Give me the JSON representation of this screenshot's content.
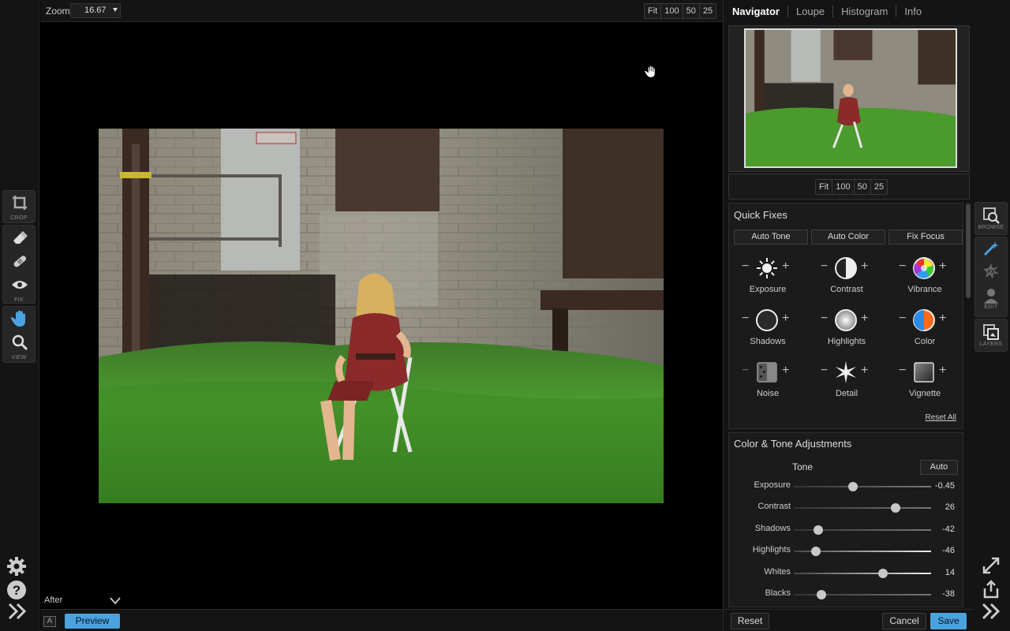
{
  "left_tools": {
    "crop_label": "CROP",
    "fix_label": "FIX",
    "view_label": "VIEW"
  },
  "top_bar": {
    "zoom_label": "Zoom",
    "zoom_value": "16.67",
    "zoom_buttons": [
      "Fit",
      "100",
      "50",
      "25"
    ]
  },
  "bottom_bar": {
    "after_label": "After",
    "a_badge": "A",
    "preview_label": "Preview"
  },
  "navigator": {
    "tabs": [
      "Navigator",
      "Loupe",
      "Histogram",
      "Info"
    ],
    "zoom_buttons": [
      "Fit",
      "100",
      "50",
      "25"
    ]
  },
  "quick_fixes": {
    "title": "Quick Fixes",
    "buttons": [
      "Auto Tone",
      "Auto Color",
      "Fix Focus"
    ],
    "items": [
      "Exposure",
      "Contrast",
      "Vibrance",
      "Shadows",
      "Highlights",
      "Color",
      "Noise",
      "Detail",
      "Vignette"
    ],
    "reset_all": "Reset All"
  },
  "adjustments": {
    "title": "Color & Tone Adjustments",
    "tone_title": "Tone",
    "auto_label": "Auto",
    "sliders": [
      {
        "label": "Exposure",
        "value": "-0.45",
        "pos": 0.43
      },
      {
        "label": "Contrast",
        "value": "26",
        "pos": 0.74
      },
      {
        "label": "Shadows",
        "value": "-42",
        "pos": 0.18
      },
      {
        "label": "Highlights",
        "value": "-46",
        "pos": 0.16
      },
      {
        "label": "Whites",
        "value": "14",
        "pos": 0.65
      },
      {
        "label": "Blacks",
        "value": "-38",
        "pos": 0.2
      }
    ]
  },
  "panel_bottom": {
    "reset": "Reset",
    "cancel": "Cancel",
    "save": "Save"
  },
  "right_strip": {
    "browse_label": "BROWSE",
    "edit_label": "EDIT",
    "layers_label": "LAYERS"
  },
  "colors": {
    "accent": "#4aa3df"
  }
}
